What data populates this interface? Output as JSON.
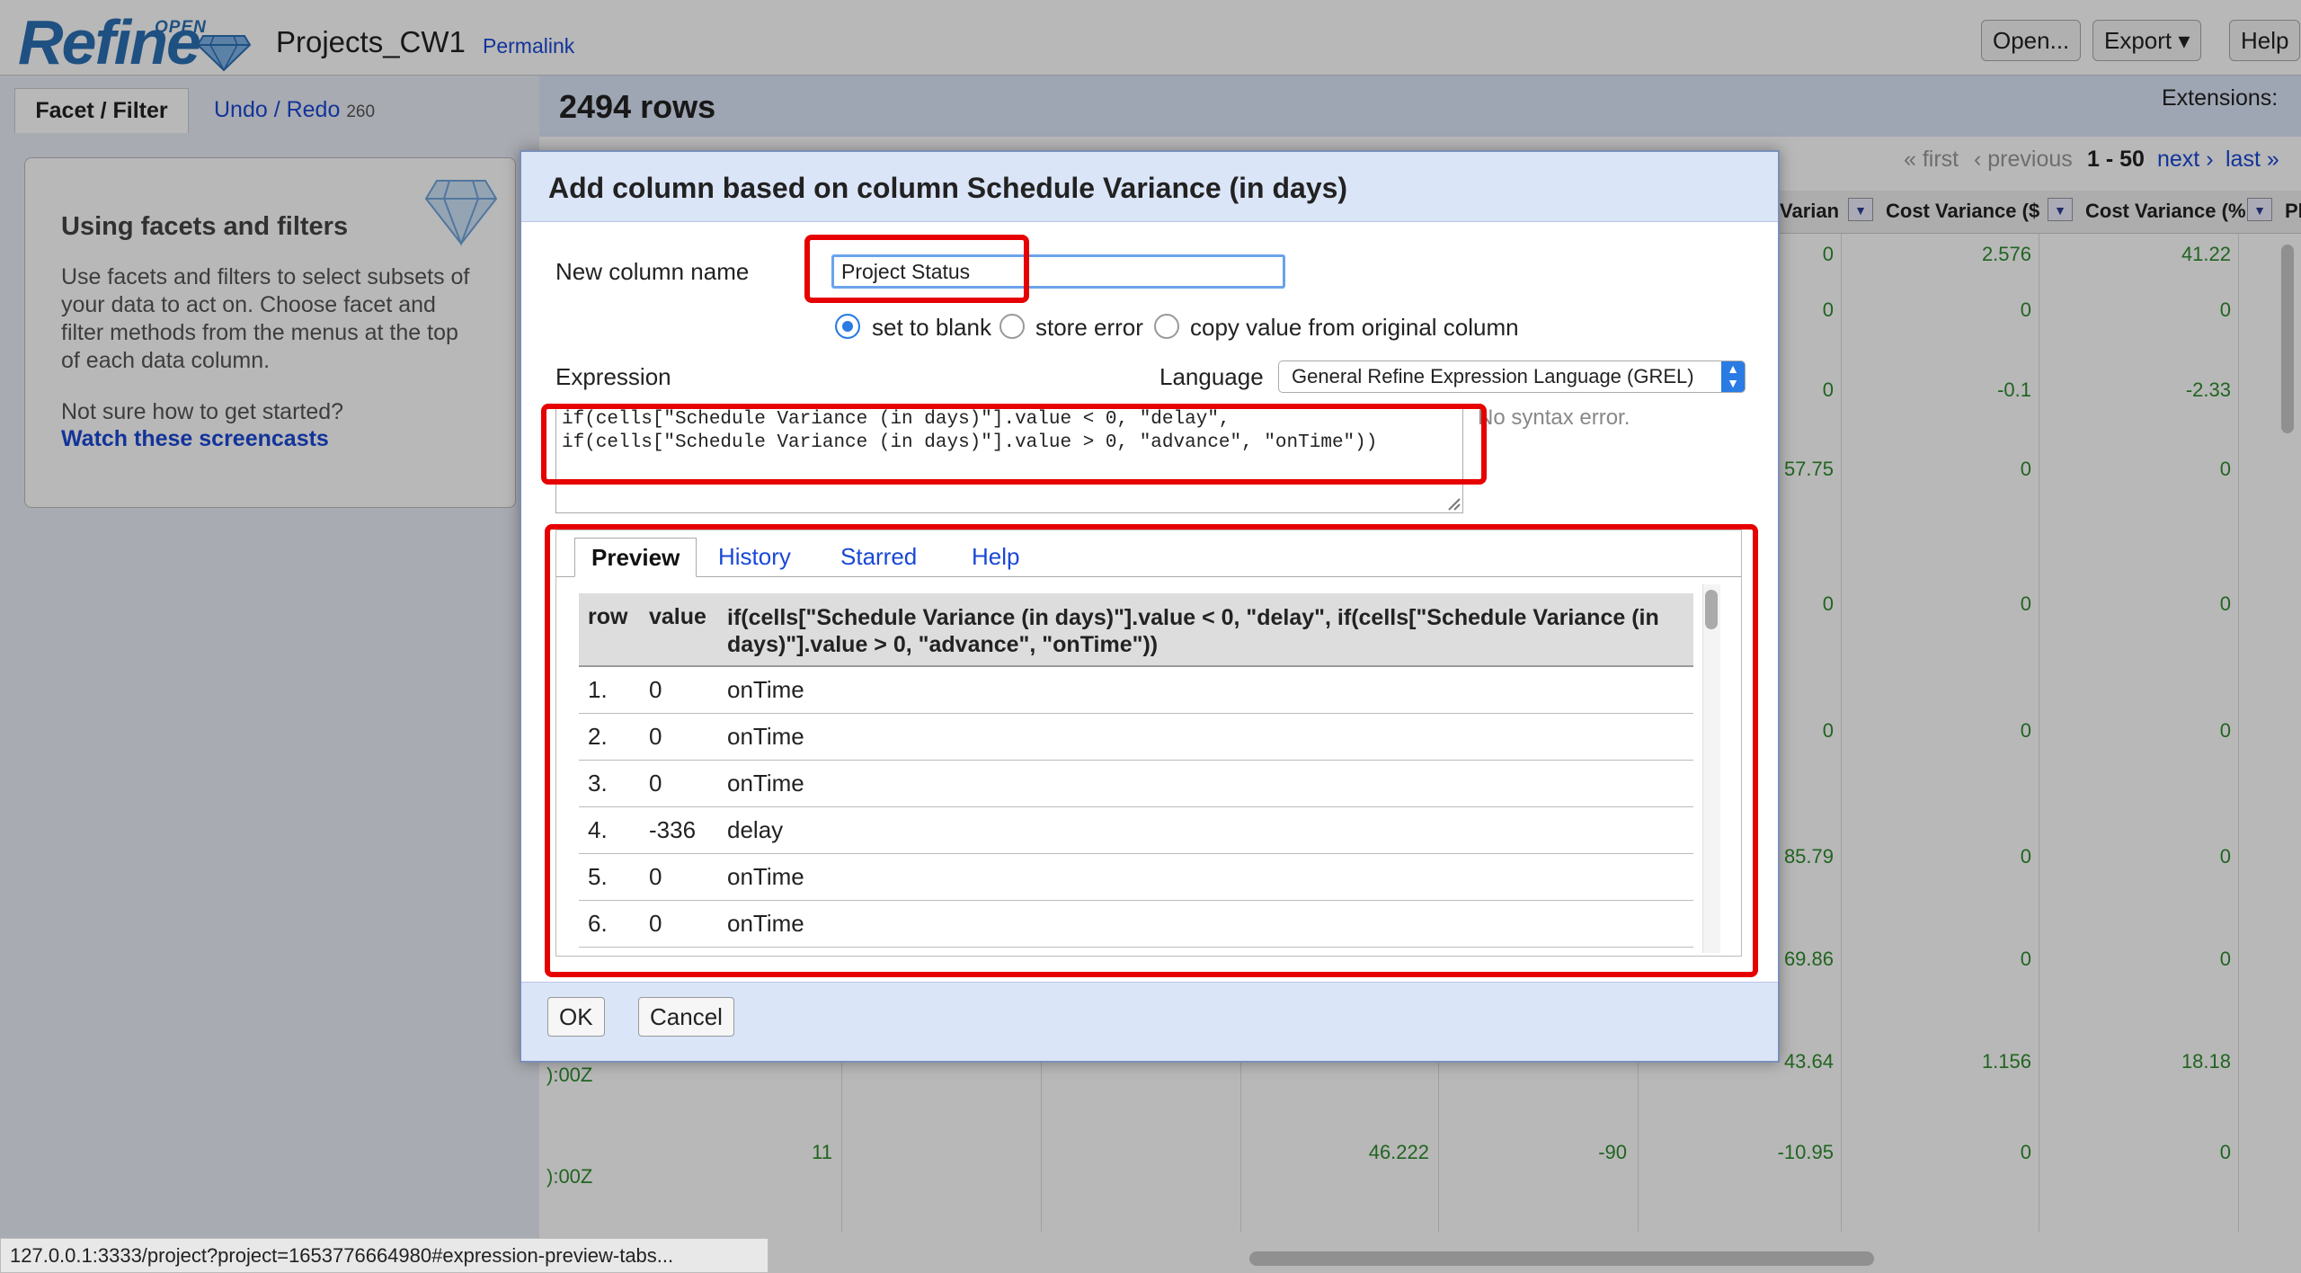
{
  "header": {
    "logo_open": "OPEN",
    "logo_text": "Refine",
    "project_name": "Projects_CW1",
    "permalink_label": "Permalink",
    "buttons": {
      "open": "Open...",
      "export": "Export ▾",
      "help": "Help"
    }
  },
  "left_panel": {
    "tab_facet": "Facet / Filter",
    "tab_undo": "Undo / Redo",
    "undo_count": "260",
    "box_title": "Using facets and filters",
    "box_text": "Use facets and filters to select subsets of your data to act on. Choose facet and filter methods from the menus at the top of each data column.",
    "help_question": "Not sure how to get started?",
    "help_link": "Watch these screencasts"
  },
  "grid": {
    "row_count": "2494 rows",
    "extensions": "Extensions:",
    "pager": {
      "first": "« first",
      "previous": "‹ previous",
      "range": "1 - 50",
      "next": "next ›",
      "last": "last »"
    },
    "columns": [
      "Varian",
      "Cost Variance ($",
      "Cost Variance (%",
      "Pl"
    ],
    "visible_values": {
      "col_a": [
        "0",
        "0",
        "0",
        "57.75",
        "0",
        "0",
        "85.79",
        "69.86",
        "43.64",
        "-10.95"
      ],
      "col_b": [
        "2.576",
        "0",
        "-0.1",
        "0",
        "0",
        "0",
        "0",
        "0",
        "1.156",
        "0"
      ],
      "col_c": [
        "41.22",
        "0",
        "-2.33",
        "0",
        "0",
        "0",
        "0",
        "0",
        "18.18",
        "0"
      ],
      "bottom_row": {
        "date_fragment_1": "):00Z",
        "date_fragment_2": "):00Z",
        "v1": "11",
        "v2": "46.222",
        "v3": "-90"
      }
    }
  },
  "status_url": "127.0.0.1:3333/project?project=1653776664980#expression-preview-tabs...",
  "dialog": {
    "title": "Add column based on column Schedule Variance (in days)",
    "new_column_label": "New column name",
    "new_column_value": "Project Status",
    "on_error": {
      "set_blank": "set to blank",
      "store_error": "store error",
      "copy_value": "copy value from original column"
    },
    "expression_label": "Expression",
    "language_label": "Language",
    "language_value": "General Refine Expression Language (GREL)",
    "expression": "if(cells[\"Schedule Variance (in days)\"].value < 0, \"delay\",\nif(cells[\"Schedule Variance (in days)\"].value > 0, \"advance\", \"onTime\"))",
    "syntax_status": "No syntax error.",
    "tabs": [
      "Preview",
      "History",
      "Starred",
      "Help"
    ],
    "preview": {
      "headers": {
        "row": "row",
        "value": "value",
        "expr": "if(cells[\"Schedule Variance (in days)\"].value < 0, \"delay\", if(cells[\"Schedule Variance (in days)\"].value > 0, \"advance\", \"onTime\"))"
      },
      "rows": [
        {
          "row": "1.",
          "value": "0",
          "result": "onTime"
        },
        {
          "row": "2.",
          "value": "0",
          "result": "onTime"
        },
        {
          "row": "3.",
          "value": "0",
          "result": "onTime"
        },
        {
          "row": "4.",
          "value": "-336",
          "result": "delay"
        },
        {
          "row": "5.",
          "value": "0",
          "result": "onTime"
        },
        {
          "row": "6.",
          "value": "0",
          "result": "onTime"
        }
      ]
    },
    "ok_label": "OK",
    "cancel_label": "Cancel"
  },
  "colors": {
    "highlight": "#e60000",
    "link": "#1a48d6",
    "grid_value": "#2e8b2e"
  }
}
